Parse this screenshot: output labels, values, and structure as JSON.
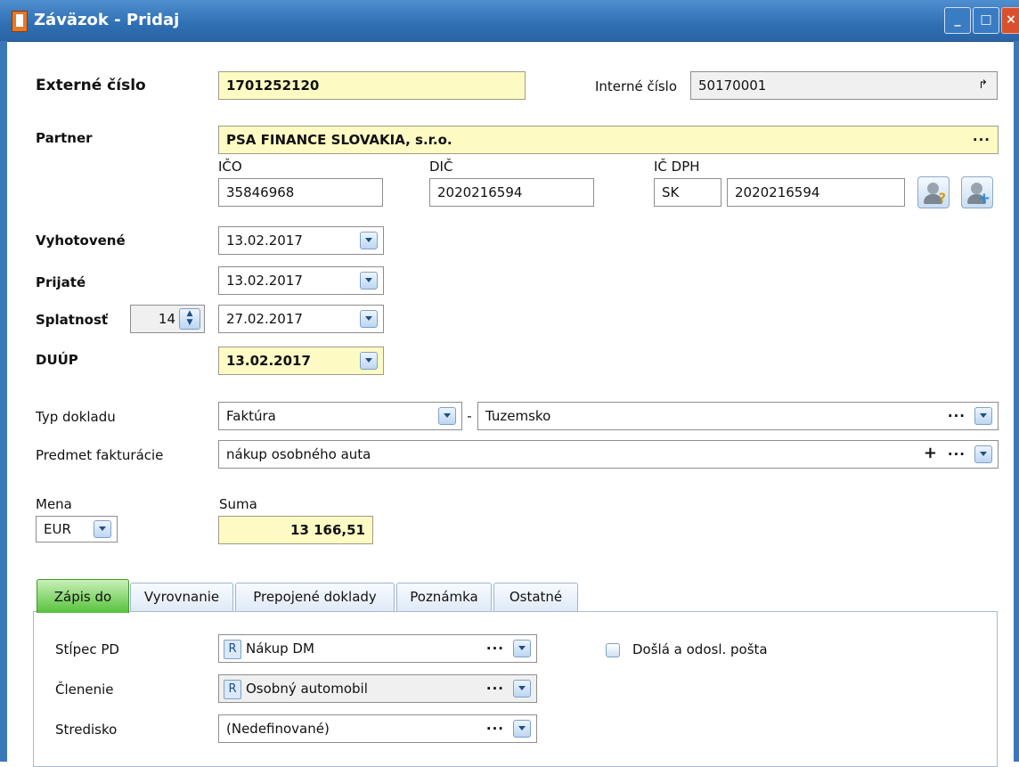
{
  "window": {
    "title": "Záväzok - Pridaj"
  },
  "fields": {
    "externe_cislo_label": "Externé číslo",
    "externe_cislo_value": "1701252120",
    "interne_cislo_label": "Interné číslo",
    "interne_cislo_value": "50170001",
    "partner_label": "Partner",
    "partner_value": "PSA FINANCE SLOVAKIA, s.r.o.",
    "ico_label": "IČO",
    "ico_value": "35846968",
    "dic_label": "DIČ",
    "dic_value": "2020216594",
    "icdph_label": "IČ DPH",
    "icdph_prefix": "SK",
    "icdph_value": "2020216594",
    "vyhotovene_label": "Vyhotovené",
    "vyhotovene_value": "13.02.2017",
    "prijate_label": "Prijaté",
    "prijate_value": "13.02.2017",
    "splatnost_label": "Splatnosť",
    "splatnost_days": "14",
    "splatnost_value": "27.02.2017",
    "duup_label": "DUÚP",
    "duup_value": "13.02.2017",
    "typ_dokladu_label": "Typ dokladu",
    "typ_dokladu_value": "Faktúra",
    "typ_dokladu_sep": "-",
    "typ_dokladu_sub": "Tuzemsko",
    "predmet_label": "Predmet fakturácie",
    "predmet_value": "nákup osobného auta",
    "mena_label": "Mena",
    "mena_value": "EUR",
    "suma_label": "Suma",
    "suma_value": "13 166,51"
  },
  "tabs": [
    {
      "label": "Zápis do",
      "active": true
    },
    {
      "label": "Vyrovnanie"
    },
    {
      "label": "Prepojené doklady"
    },
    {
      "label": "Poznámka"
    },
    {
      "label": "Ostatné"
    }
  ],
  "tab_zapis": {
    "stlpec_label": "Stĺpec PD",
    "stlpec_badge": "R",
    "stlpec_value": "Nákup DM",
    "clenenie_label": "Členenie",
    "clenenie_badge": "R",
    "clenenie_value": "Osobný automobil",
    "stredisko_label": "Stredisko",
    "stredisko_value": "(Nedefinované)",
    "posta_label": "Došlá a odosl. pošta",
    "posta_checked": false
  },
  "icons": [
    "app-icon",
    "minimize-icon",
    "maximize-icon",
    "close-icon",
    "dropdown-icon",
    "ellipsis-icon",
    "plus-icon",
    "external-link-icon",
    "person-search-icon",
    "person-add-icon",
    "spinner-icon"
  ]
}
